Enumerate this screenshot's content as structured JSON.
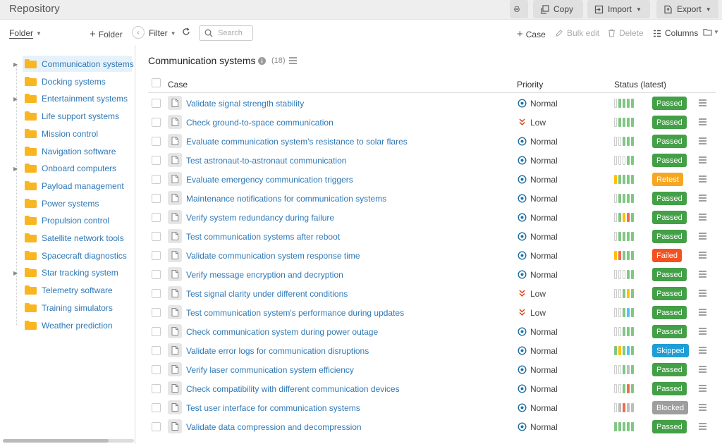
{
  "header": {
    "title": "Repository",
    "print_label": "",
    "copy_label": "Copy",
    "import_label": "Import",
    "export_label": "Export"
  },
  "toolbar": {
    "folder_label": "Folder",
    "add_folder_label": "Folder",
    "filter_label": "Filter",
    "search_placeholder": "Search",
    "add_case_label": "Case",
    "bulk_edit_label": "Bulk edit",
    "delete_label": "Delete",
    "columns_label": "Columns"
  },
  "sidebar": {
    "items": [
      {
        "label": "Communication systems",
        "expandable": true,
        "selected": true
      },
      {
        "label": "Docking systems",
        "expandable": false,
        "selected": false
      },
      {
        "label": "Entertainment systems",
        "expandable": true,
        "selected": false
      },
      {
        "label": "Life support systems",
        "expandable": false,
        "selected": false
      },
      {
        "label": "Mission control",
        "expandable": false,
        "selected": false
      },
      {
        "label": "Navigation software",
        "expandable": false,
        "selected": false
      },
      {
        "label": "Onboard computers",
        "expandable": true,
        "selected": false
      },
      {
        "label": "Payload management",
        "expandable": false,
        "selected": false
      },
      {
        "label": "Power systems",
        "expandable": false,
        "selected": false
      },
      {
        "label": "Propulsion control",
        "expandable": false,
        "selected": false
      },
      {
        "label": "Satellite network tools",
        "expandable": false,
        "selected": false
      },
      {
        "label": "Spacecraft diagnostics",
        "expandable": false,
        "selected": false
      },
      {
        "label": "Star tracking system",
        "expandable": true,
        "selected": false
      },
      {
        "label": "Telemetry software",
        "expandable": false,
        "selected": false
      },
      {
        "label": "Training simulators",
        "expandable": false,
        "selected": false
      },
      {
        "label": "Weather prediction",
        "expandable": false,
        "selected": false
      }
    ]
  },
  "main": {
    "title": "Communication systems",
    "count": "(18)",
    "columns": {
      "case": "Case",
      "priority": "Priority",
      "status": "Status (latest)"
    }
  },
  "colors": {
    "passed": "#43a047",
    "retest": "#f5a623",
    "failed": "#f4511e",
    "skipped": "#1e9ed6",
    "blocked": "#9e9e9e",
    "link": "#2e78b7",
    "bar_green": "#81c784",
    "bar_yellow": "#ffc107",
    "bar_red": "#ef6c4f",
    "bar_blue": "#4fc3f7",
    "bar_grey": "#bdbdbd"
  },
  "cases": [
    {
      "title": "Validate signal strength stability",
      "priority": "Normal",
      "status": "Passed",
      "history": [
        "empty",
        "green",
        "green",
        "green",
        "green"
      ]
    },
    {
      "title": "Check ground-to-space communication",
      "priority": "Low",
      "status": "Passed",
      "history": [
        "empty",
        "green",
        "green",
        "green",
        "green"
      ]
    },
    {
      "title": "Evaluate communication system's resistance to solar flares",
      "priority": "Normal",
      "status": "Passed",
      "history": [
        "empty",
        "empty",
        "green",
        "green",
        "green"
      ]
    },
    {
      "title": "Test astronaut-to-astronaut communication",
      "priority": "Normal",
      "status": "Passed",
      "history": [
        "empty",
        "empty",
        "empty",
        "green",
        "green"
      ]
    },
    {
      "title": "Evaluate emergency communication triggers",
      "priority": "Normal",
      "status": "Retest",
      "history": [
        "yellow",
        "green",
        "green",
        "green",
        "green"
      ]
    },
    {
      "title": "Maintenance notifications for communication systems",
      "priority": "Normal",
      "status": "Passed",
      "history": [
        "empty",
        "green",
        "green",
        "green",
        "green"
      ]
    },
    {
      "title": "Verify system redundancy during failure",
      "priority": "Normal",
      "status": "Passed",
      "history": [
        "empty",
        "green",
        "yellow",
        "red",
        "green"
      ]
    },
    {
      "title": "Test communication systems after reboot",
      "priority": "Normal",
      "status": "Passed",
      "history": [
        "empty",
        "green",
        "green",
        "green",
        "green"
      ]
    },
    {
      "title": "Validate communication system response time",
      "priority": "Normal",
      "status": "Failed",
      "history": [
        "yellow",
        "red",
        "green",
        "green",
        "green"
      ]
    },
    {
      "title": "Verify message encryption and decryption",
      "priority": "Normal",
      "status": "Passed",
      "history": [
        "empty",
        "empty",
        "empty",
        "green",
        "green"
      ]
    },
    {
      "title": "Test signal clarity under different conditions",
      "priority": "Low",
      "status": "Passed",
      "history": [
        "empty",
        "empty",
        "green",
        "yellow",
        "green"
      ]
    },
    {
      "title": "Test communication system's performance during updates",
      "priority": "Low",
      "status": "Passed",
      "history": [
        "empty",
        "empty",
        "green",
        "blue",
        "green"
      ]
    },
    {
      "title": "Check communication system during power outage",
      "priority": "Normal",
      "status": "Passed",
      "history": [
        "empty",
        "empty",
        "green",
        "green",
        "green"
      ]
    },
    {
      "title": "Validate error logs for communication disruptions",
      "priority": "Normal",
      "status": "Skipped",
      "history": [
        "green",
        "yellow",
        "green",
        "blue",
        "green"
      ]
    },
    {
      "title": "Verify laser communication system efficiency",
      "priority": "Normal",
      "status": "Passed",
      "history": [
        "empty",
        "empty",
        "green",
        "grey",
        "green"
      ]
    },
    {
      "title": "Check compatibility with different communication devices",
      "priority": "Normal",
      "status": "Passed",
      "history": [
        "empty",
        "empty",
        "green",
        "red",
        "green"
      ]
    },
    {
      "title": "Test user interface for communication systems",
      "priority": "Normal",
      "status": "Blocked",
      "history": [
        "empty",
        "grey",
        "red",
        "grey",
        "grey"
      ]
    },
    {
      "title": "Validate data compression and decompression",
      "priority": "Normal",
      "status": "Passed",
      "history": [
        "green",
        "green",
        "green",
        "green",
        "green"
      ]
    }
  ]
}
